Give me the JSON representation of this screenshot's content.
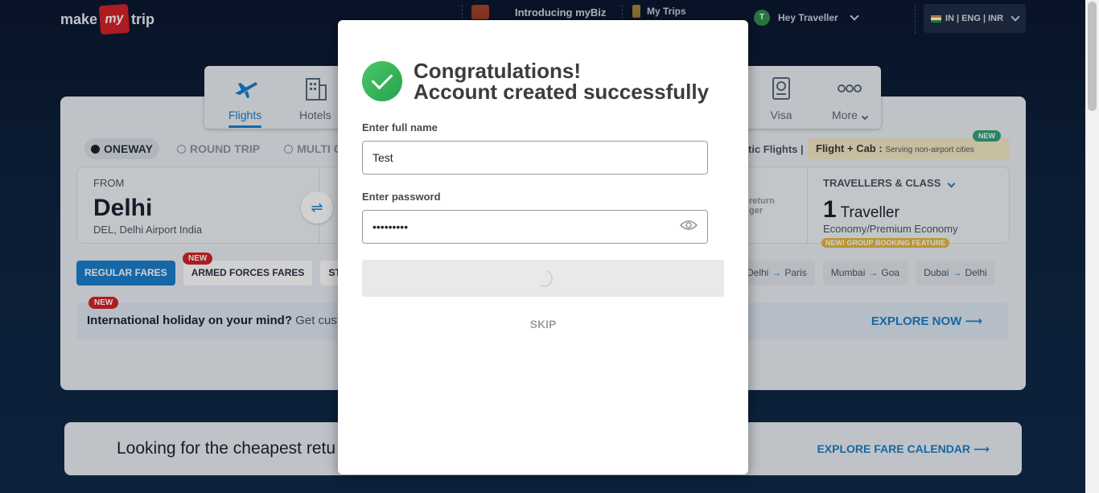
{
  "header": {
    "logo_make": "make",
    "logo_my": "my",
    "logo_trip": "trip",
    "mybiz_label": "Introducing myBiz",
    "trips_label": "My Trips",
    "user_initial": "T",
    "user_greeting": "Hey Traveller",
    "locale": "IN | ENG | INR"
  },
  "tabs": [
    {
      "label": "Flights",
      "icon": "plane-icon"
    },
    {
      "label": "Hotels",
      "icon": "hotel-icon"
    },
    {
      "label": "Visa",
      "icon": "passport-icon"
    },
    {
      "label": "More",
      "icon": "more-dots-icon"
    }
  ],
  "trip_types": {
    "oneway": "ONEWAY",
    "round": "ROUND TRIP",
    "multi": "MULTI C"
  },
  "intl_flights": "tic Flights |",
  "flight_cab": {
    "title": "Flight + Cab :",
    "sub": "Serving non-airport cities",
    "badge": "NEW"
  },
  "search": {
    "from_label": "FROM",
    "from_city": "Delhi",
    "from_airport": "DEL, Delhi Airport India",
    "return_hint_1": "return",
    "return_hint_2": "ger",
    "travellers_label": "TRAVELLERS & CLASS",
    "travellers_count": "1",
    "travellers_word": "Traveller",
    "travel_class": "Economy/Premium Economy",
    "group_badge": "NEW! GROUP BOOKING FEATURE"
  },
  "fares": {
    "regular": "REGULAR FARES",
    "armed": "ARMED FORCES FARES",
    "student": "STUD",
    "new_badge": "NEW"
  },
  "routes": [
    {
      "from": "Delhi",
      "to": "Paris"
    },
    {
      "from": "Mumbai",
      "to": "Goa"
    },
    {
      "from": "Dubai",
      "to": "Delhi"
    }
  ],
  "holiday": {
    "badge": "NEW",
    "text_bold": "International holiday on your mind?",
    "text_rest": " Get cust",
    "cta": "EXPLORE NOW ⟶"
  },
  "bottom_banner": {
    "text": "Looking for the cheapest retu",
    "cta": "EXPLORE FARE CALENDAR ⟶"
  },
  "modal": {
    "title_line1": "Congratulations!",
    "title_line2": "Account created successfully",
    "name_label": "Enter full name",
    "name_value": "Test",
    "password_label": "Enter password",
    "password_value": "•••••••••",
    "skip_label": "SKIP"
  }
}
